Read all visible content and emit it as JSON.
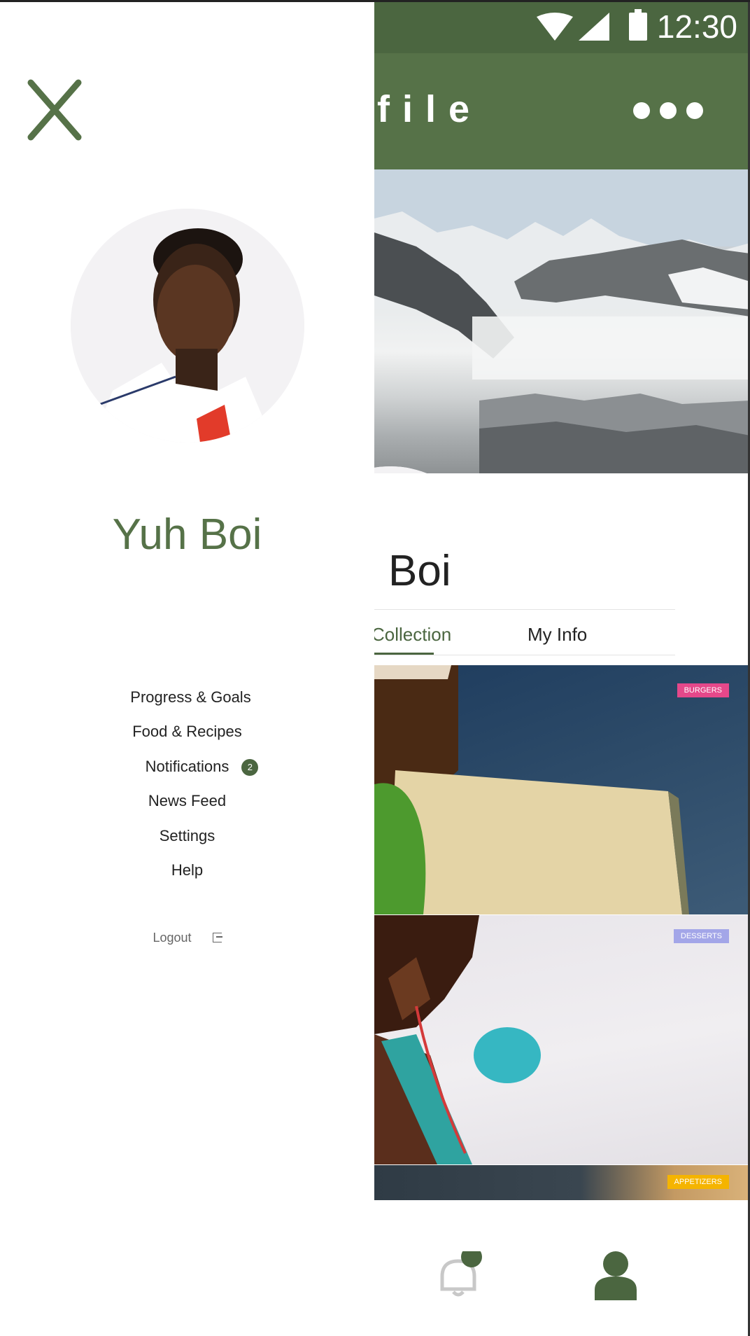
{
  "status_bar": {
    "time": "12:30"
  },
  "app_bar": {
    "title_partial": "file"
  },
  "profile": {
    "name_partial": "Boi",
    "tabs": [
      {
        "label": "Collection",
        "active": true
      },
      {
        "label": "My Info",
        "active": false
      }
    ]
  },
  "cards": [
    {
      "badge": "BURGERS",
      "badge_color": "#e5488a"
    },
    {
      "badge": "DESSERTS",
      "badge_color": "#a3a6e8"
    },
    {
      "badge": "APPETIZERS",
      "badge_color": "#f5b400"
    }
  ],
  "drawer": {
    "user_name": "Yuh Boi",
    "menu": [
      {
        "label": "Progress & Goals"
      },
      {
        "label": "Food & Recipes"
      },
      {
        "label": "Notifications",
        "badge": "2"
      },
      {
        "label": "News Feed"
      },
      {
        "label": "Settings"
      },
      {
        "label": "Help"
      }
    ],
    "logout_label": "Logout"
  },
  "icons": {
    "close": "close-icon",
    "more": "more-horizontal-icon",
    "notifications": "bell-icon",
    "profile": "user-icon",
    "logout": "logout-icon"
  },
  "colors": {
    "primary_green": "#567248",
    "dark_green": "#4b6640"
  }
}
